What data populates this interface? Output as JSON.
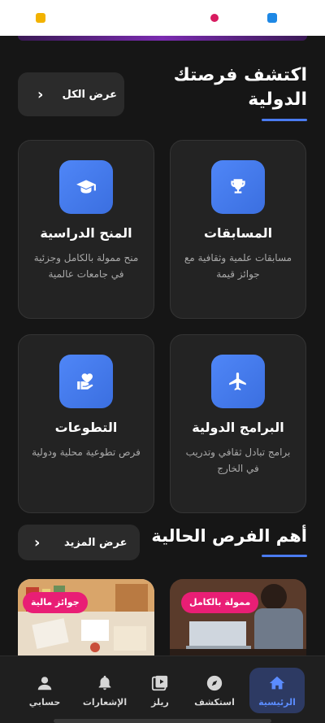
{
  "header": {
    "colors": {
      "accent": "#4a7bf0",
      "badge": "#e91e75",
      "active_tab_bg": "#2d3a63"
    }
  },
  "discover": {
    "title": "اكتشف فرصتك الدولية",
    "view_all_label": "عرض الكل"
  },
  "cards": [
    {
      "title": "المنح الدراسية",
      "desc": "منح ممولة بالكامل وجزئية في جامعات عالمية",
      "icon": "graduation-cap-icon"
    },
    {
      "title": "المسابقات",
      "desc": "مسابقات علمية وثقافية مع جوائز قيمة",
      "icon": "trophy-icon"
    },
    {
      "title": "التطوعات",
      "desc": "فرص تطوعية محلية ودولية",
      "icon": "heart-hand-icon"
    },
    {
      "title": "البرامج الدولية",
      "desc": "برامج تبادل ثقافي وتدريب في الخارج",
      "icon": "airplane-icon"
    }
  ],
  "top_opportunities": {
    "title": "أهم الفرص الحالية",
    "more_label": "عرض المزيد",
    "items": [
      {
        "badge": "جوائز مالية"
      },
      {
        "badge": "ممولة بالكامل"
      }
    ]
  },
  "tabbar": {
    "tabs": [
      {
        "label": "الرئيسية",
        "icon": "home-icon",
        "active": true
      },
      {
        "label": "استكشف",
        "icon": "compass-icon",
        "active": false
      },
      {
        "label": "ريلز",
        "icon": "reels-icon",
        "active": false
      },
      {
        "label": "الإشعارات",
        "icon": "bell-icon",
        "active": false
      },
      {
        "label": "حسابي",
        "icon": "user-icon",
        "active": false
      }
    ]
  }
}
